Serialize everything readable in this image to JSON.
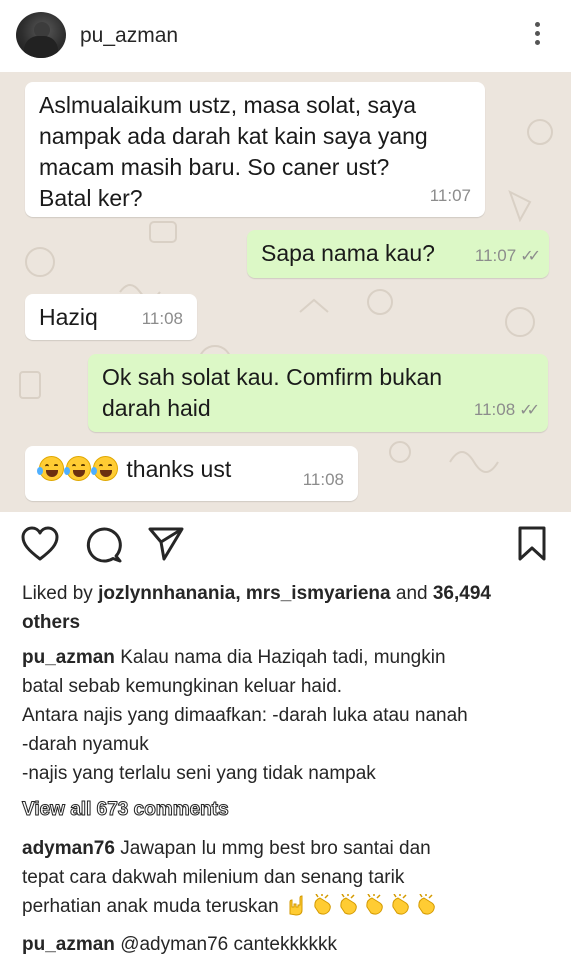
{
  "header": {
    "username": "pu_azman"
  },
  "chat": {
    "messages": [
      {
        "direction": "incoming",
        "text_lines": [
          "Aslmualaikum ustz, masa solat, saya",
          "nampak ada darah kat kain saya yang",
          "macam masih baru. So caner ust?",
          "Batal ker?"
        ],
        "time": "11:07"
      },
      {
        "direction": "outgoing",
        "text": "Sapa nama kau?",
        "time": "11:07"
      },
      {
        "direction": "incoming",
        "text": "Haziq",
        "time": "11:08"
      },
      {
        "direction": "outgoing",
        "text_lines": [
          "Ok sah solat kau. Comfirm bukan",
          "darah haid"
        ],
        "time": "11:08"
      },
      {
        "direction": "incoming",
        "text": "thanks ust",
        "emoji": "joy-emoji",
        "emoji_count": 3,
        "time": "11:08"
      }
    ],
    "colors": {
      "background": "#ece5dd",
      "incoming": "#ffffff",
      "outgoing": "#dcf8c6"
    }
  },
  "actions": {
    "icons": [
      "heart-icon",
      "comment-icon",
      "share-icon",
      "bookmark-icon"
    ]
  },
  "likes": {
    "prefix": "Liked by",
    "users": [
      "jozlynnhanania",
      "mrs_ismyariena"
    ],
    "separator": ",",
    "and_text": "and",
    "count": "36,494",
    "others": "others"
  },
  "caption": {
    "username": "pu_azman",
    "lines": [
      "Kalau nama dia Haziqah tadi, mungkin",
      "batal sebab kemungkinan keluar haid.",
      "Antara najis yang dimaafkan: -darah luka atau nanah",
      "-darah nyamuk",
      "-najis yang terlalu seni yang tidak nampak"
    ]
  },
  "view_all": {
    "prefix": "View all",
    "count": "673",
    "suffix": "comments"
  },
  "comments": [
    {
      "username": "adyman76",
      "lines": [
        "Jawapan lu mmg best bro santai dan",
        "tepat cara dakwah milenium dan senang tarik",
        "perhatian anak muda teruskan"
      ],
      "emojis": [
        "horns-emoji",
        "clap-emoji",
        "clap-emoji",
        "clap-emoji",
        "clap-emoji",
        "clap-emoji"
      ]
    },
    {
      "username": "pu_azman",
      "text": "@adyman76 cantekkkkkk"
    }
  ]
}
